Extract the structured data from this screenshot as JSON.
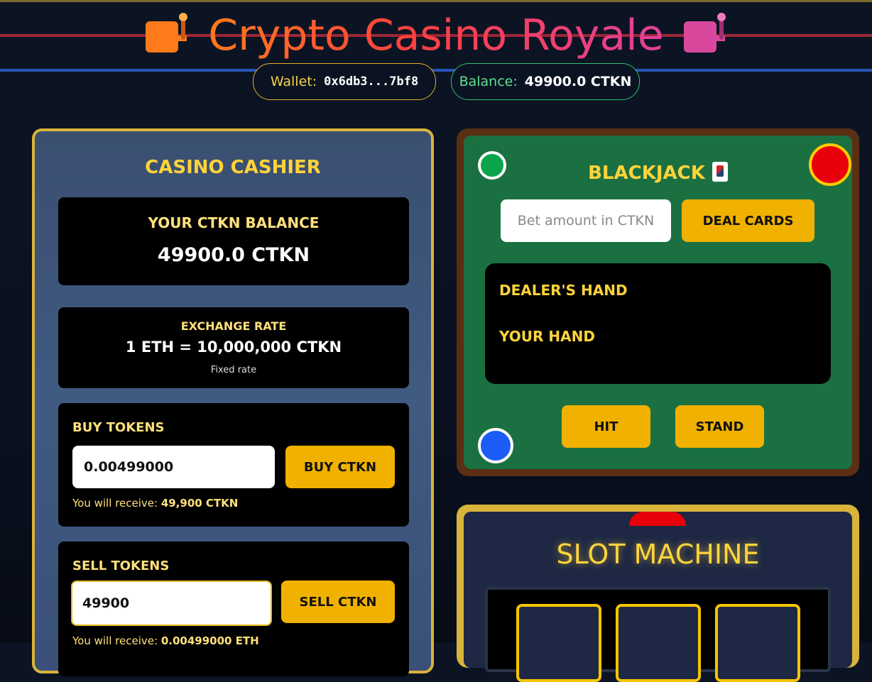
{
  "header": {
    "title": "Crypto Casino Royale",
    "left_icon": "slot-machine-icon",
    "right_icon": "slot-machine-icon",
    "wallet_label": "Wallet:",
    "wallet_value": "0x6db3...7bf8",
    "balance_label": "Balance:",
    "balance_value": "49900.0 CTKN"
  },
  "cashier": {
    "title": "CASINO CASHIER",
    "balance_label": "YOUR CTKN BALANCE",
    "balance_value": "49900.0 CTKN",
    "rate_label": "EXCHANGE RATE",
    "rate_value": "1 ETH = 10,000,000 CTKN",
    "rate_note": "Fixed rate",
    "buy": {
      "label": "BUY TOKENS",
      "input_value": "0.00499000",
      "button": "BUY CTKN",
      "receive_prefix": "You will receive:",
      "receive_value": "49,900 CTKN"
    },
    "sell": {
      "label": "SELL TOKENS",
      "input_value": "49900",
      "button": "SELL CTKN",
      "receive_prefix": "You will receive:",
      "receive_value": "0.00499000 ETH"
    }
  },
  "blackjack": {
    "title": "BLACKJACK",
    "title_icon": "joker-card-icon",
    "bet_placeholder": "Bet amount in CTKN",
    "deal_button": "DEAL CARDS",
    "dealer_label": "DEALER'S HAND",
    "player_label": "YOUR HAND",
    "hit_button": "HIT",
    "stand_button": "STAND"
  },
  "slots": {
    "title": "SLOT MACHINE"
  },
  "colors": {
    "accent_gold": "#f0b100",
    "felt_green": "#1b7042",
    "text_gold": "#ffd43a",
    "wallet_border": "#e2b02a",
    "balance_border": "#2cc06a"
  }
}
